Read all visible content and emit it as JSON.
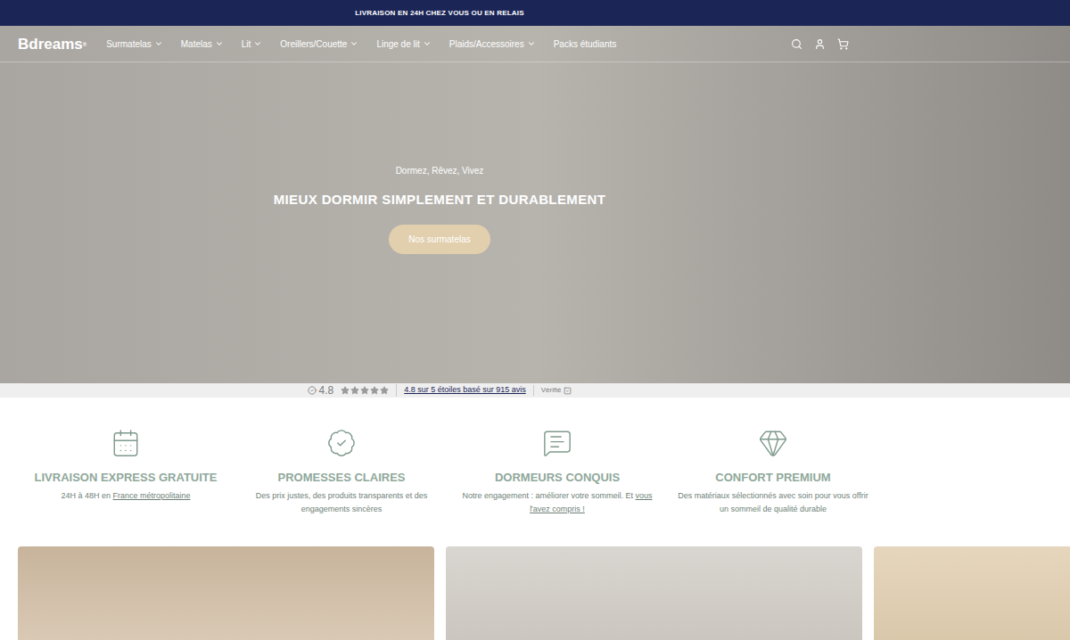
{
  "banner": {
    "text": "LIVRAISON EN 24H CHEZ VOUS OU EN RELAIS"
  },
  "header": {
    "logo": "Bdreams",
    "logo_mark": "®",
    "nav": [
      {
        "label": "Surmatelas",
        "dropdown": true
      },
      {
        "label": "Matelas",
        "dropdown": true
      },
      {
        "label": "Lit",
        "dropdown": true
      },
      {
        "label": "Oreillers/Couette",
        "dropdown": true
      },
      {
        "label": "Linge de lit",
        "dropdown": true
      },
      {
        "label": "Plaids/Accessoires",
        "dropdown": true
      },
      {
        "label": "Packs étudiants",
        "dropdown": false
      }
    ]
  },
  "hero": {
    "subtitle": "Dormez, Rêvez, Vivez",
    "title": "MIEUX DORMIR SIMPLEMENT ET DURABLEMENT",
    "button": "Nos surmatelas"
  },
  "reviews": {
    "rating": "4.8",
    "stars": 5,
    "summary": "4.8 sur 5 étoiles basé sur 915 avis",
    "verified": "Vérifié"
  },
  "features": [
    {
      "kind": "delivery",
      "title": "LIVRAISON EXPRESS GRATUITE",
      "desc": "24H à 48H en ",
      "link": "France métropolitaine"
    },
    {
      "kind": "promise",
      "title": "PROMESSES CLAIRES",
      "desc": "Des prix justes, des produits transparents et des engagements sincères",
      "link": ""
    },
    {
      "kind": "reviews",
      "title": "DORMEURS CONQUIS",
      "desc": "Notre engagement : améliorer votre sommeil. Et ",
      "link": "vous l'avez compris !"
    },
    {
      "kind": "comfort",
      "title": "CONFORT PREMIUM",
      "desc": "Des matériaux sélectionnés avec soin pour vous offrir un sommeil de qualité durable",
      "link": ""
    }
  ]
}
